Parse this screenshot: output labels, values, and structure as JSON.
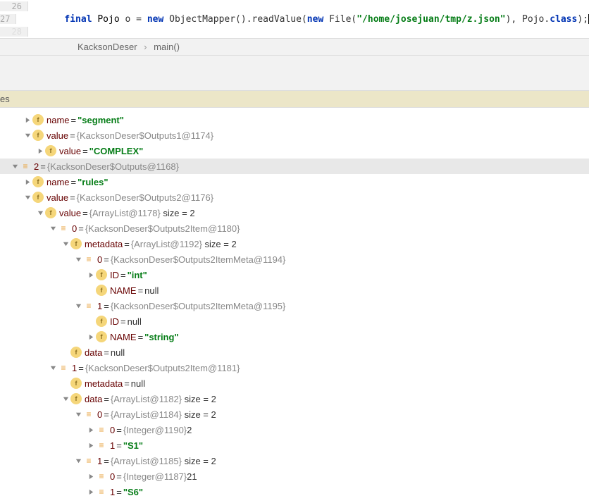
{
  "editor": {
    "line26": "26",
    "line27": "27",
    "line28": "28",
    "code": {
      "kw_final": "final",
      "type_pojo": "Pojo",
      "var_o": " o ",
      "eq": "= ",
      "kw_new1": "new",
      "obj_mapper": " ObjectMapper().readValue(",
      "kw_new2": "new",
      "file_call": " File(",
      "str_path": "\"/home/josejuan/tmp/z.json\"",
      "close1": "), Pojo.",
      "kw_class": "class",
      "close2": ");"
    }
  },
  "breadcrumb": {
    "item1": "KacksonDeser",
    "item2": "main()"
  },
  "tab": {
    "label": "es"
  },
  "tree": {
    "r0": {
      "name": "name",
      "val": "\"segment\""
    },
    "r1": {
      "name": "value",
      "ref": "{KacksonDeser$Outputs1@1174}"
    },
    "r2": {
      "name": "value",
      "val": "\"COMPLEX\""
    },
    "r3": {
      "idx": "2",
      "ref": "{KacksonDeser$Outputs@1168}"
    },
    "r4": {
      "name": "name",
      "val": "\"rules\""
    },
    "r5": {
      "name": "value",
      "ref": "{KacksonDeser$Outputs2@1176}"
    },
    "r6": {
      "name": "value",
      "ref": "{ArrayList@1178}",
      "size": "size = 2"
    },
    "r7": {
      "idx": "0",
      "ref": "{KacksonDeser$Outputs2Item@1180}"
    },
    "r8": {
      "name": "metadata",
      "ref": "{ArrayList@1192}",
      "size": "size = 2"
    },
    "r9": {
      "idx": "0",
      "ref": "{KacksonDeser$Outputs2ItemMeta@1194}"
    },
    "r10": {
      "name": "ID",
      "val": "\"int\""
    },
    "r11": {
      "name": "NAME",
      "null": "null"
    },
    "r12": {
      "idx": "1",
      "ref": "{KacksonDeser$Outputs2ItemMeta@1195}"
    },
    "r13": {
      "name": "ID",
      "null": "null"
    },
    "r14": {
      "name": "NAME",
      "val": "\"string\""
    },
    "r15": {
      "name": "data",
      "null": "null"
    },
    "r16": {
      "idx": "1",
      "ref": "{KacksonDeser$Outputs2Item@1181}"
    },
    "r17": {
      "name": "metadata",
      "null": "null"
    },
    "r18": {
      "name": "data",
      "ref": "{ArrayList@1182}",
      "size": "size = 2"
    },
    "r19": {
      "idx": "0",
      "ref": "{ArrayList@1184}",
      "size": "size = 2"
    },
    "r20": {
      "idx": "0",
      "ref": "{Integer@1190}",
      "num": "2"
    },
    "r21": {
      "idx": "1",
      "val": "\"S1\""
    },
    "r22": {
      "idx": "1",
      "ref": "{ArrayList@1185}",
      "size": "size = 2"
    },
    "r23": {
      "idx": "0",
      "ref": "{Integer@1187}",
      "num": "21"
    },
    "r24": {
      "idx": "1",
      "val": "\"S6\""
    }
  }
}
